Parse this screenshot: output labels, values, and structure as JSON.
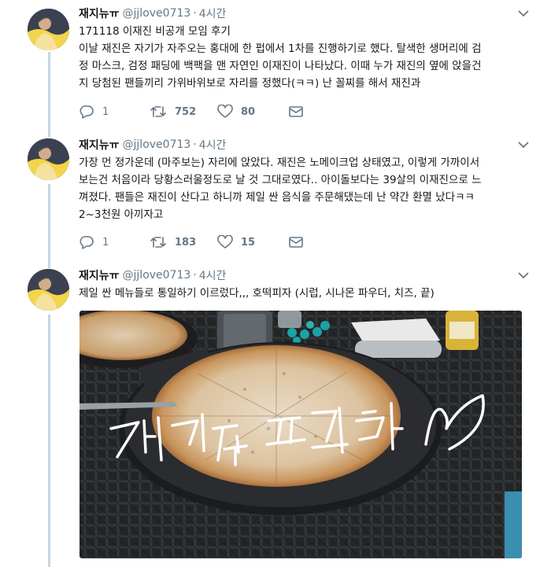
{
  "tweets": [
    {
      "name": "재지뉴ㅠ",
      "handle": "@jjlove0713",
      "time": "4시간",
      "lines": [
        "171118 이재진 비공개 모임 후기",
        "이날 재진은 자기가 자주오는 홍대에 한 펍에서 1차를 진행하기로 했다. 탈색한 생머리에 검",
        "정 마스크, 검정 패딩에 백팩을 맨 자연인 이재진이 나타났다. 이때 누가 재진의 옆에 앉을건",
        "지 당첨된 팬들끼리 가위바위보로 자리를 정했다(ㅋㅋ) 난 꼴찌를 해서 재진과"
      ],
      "replies": "1",
      "retweets": "752",
      "likes": "80"
    },
    {
      "name": "재지뉴ㅠ",
      "handle": "@jjlove0713",
      "time": "4시간",
      "lines": [
        "가장 먼 정가운데 (마주보는) 자리에 앉았다. 재진은 노메이크업 상태였고, 이렇게 가까이서",
        "보는건 처음이라 당황스러울정도로 날 것 그대로였다.. 아이돌보다는 39살의 이재진으로 느",
        "껴졌다. 팬들은 재진이 산다고 하니까 제일 싼 음식을 주문해댔는데 난 약간 환멸 났다ㅋㅋ",
        "2~3천원 아끼자고"
      ],
      "replies": "1",
      "retweets": "183",
      "likes": "15"
    },
    {
      "name": "재지뉴ㅠ",
      "handle": "@jjlove0713",
      "time": "4시간",
      "lines": [
        "제일 싼 메뉴들로 통일하기 이르렀다,,, 호떡피자 (시럽, 시나몬 파우더, 치즈, 끝)"
      ],
      "photo_caption": "재지뉴 프리뷰"
    }
  ],
  "colors": {
    "text": "#14171a",
    "secondary": "#657786",
    "thread_line": "#c4d6e4"
  },
  "icons": [
    "reply-icon",
    "retweet-icon",
    "like-icon",
    "dm-icon",
    "chevron-down-icon"
  ]
}
